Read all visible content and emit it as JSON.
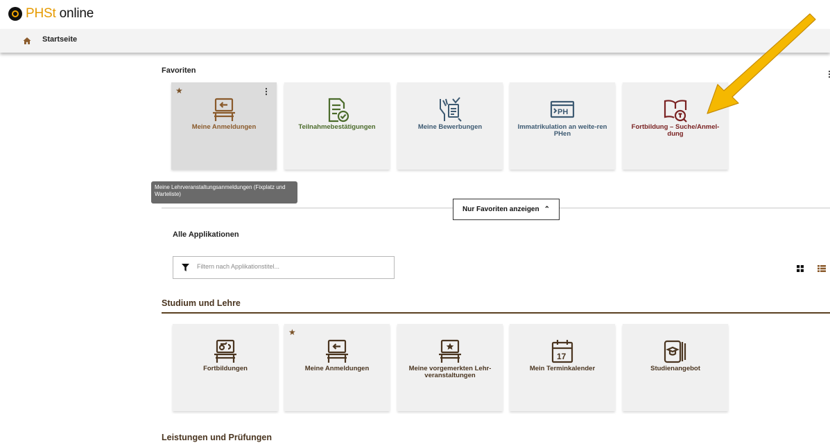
{
  "app": {
    "logo_prefix": "PHSt",
    "logo_suffix": " online"
  },
  "nav": {
    "home_label": "Startseite"
  },
  "favorites": {
    "title": "Favoriten",
    "tiles": [
      {
        "label": "Meine Anmeldungen",
        "icon": "bench-arrow-icon",
        "starred": true,
        "color": "#8a5a2b"
      },
      {
        "label": "Teilnahmebestätigungen",
        "icon": "document-check-icon",
        "color": "#4b6b2b"
      },
      {
        "label": "Meine Bewerbungen",
        "icon": "hand-document-icon",
        "color": "#3d5a72"
      },
      {
        "label": "Immatrikulation an weite-ren PHen",
        "icon": "ph-portal-icon",
        "color": "#3d5a72"
      },
      {
        "label": "Fortbildung – Suche/Anmel-dung",
        "icon": "book-search-icon",
        "color": "#7a2222"
      }
    ],
    "tooltip": "Meine Lehrveranstaltungsanmeldungen (Fixplatz und Warteliste)",
    "toggle_label": "Nur Favoriten anzeigen"
  },
  "all_apps": {
    "title": "Alle Applikationen",
    "filter_placeholder": "Filtern nach Applikationstitel..."
  },
  "groups": [
    {
      "title": "Studium und Lehre",
      "tiles": [
        {
          "label": "Fortbildungen",
          "icon": "teacher-bench-icon"
        },
        {
          "label": "Meine Anmeldungen",
          "icon": "bench-arrow-icon",
          "starred": true
        },
        {
          "label": "Meine vorgemerkten Lehr-veranstaltungen",
          "icon": "bench-star-icon"
        },
        {
          "label": "Mein Terminkalender",
          "icon": "calendar-icon",
          "day": "17"
        },
        {
          "label": "Studienangebot",
          "icon": "books-graduation-icon"
        }
      ]
    },
    {
      "title": "Leistungen und Prüfungen"
    }
  ],
  "colors": {
    "accent_brown": "#5a4020",
    "logo_orange": "#e69a00",
    "arrow_yellow": "#f5b800"
  }
}
